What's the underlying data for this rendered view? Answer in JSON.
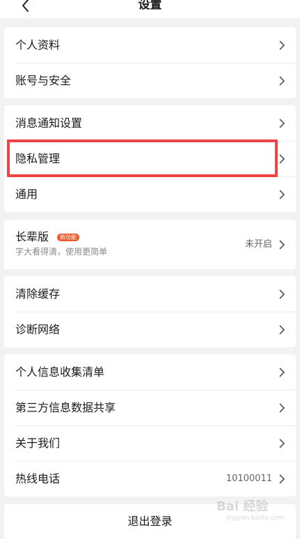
{
  "nav": {
    "title": "设置"
  },
  "groups": [
    {
      "items": [
        {
          "label": "个人资料"
        },
        {
          "label": "账号与安全"
        }
      ]
    },
    {
      "items": [
        {
          "label": "消息通知设置"
        },
        {
          "label": "隐私管理"
        },
        {
          "label": "通用"
        }
      ]
    },
    {
      "elder": {
        "label": "长辈版",
        "badge": "新功能",
        "subtitle": "字大看得清，使用更简单",
        "value": "未开启"
      }
    },
    {
      "items": [
        {
          "label": "清除缓存"
        },
        {
          "label": "诊断网络"
        }
      ]
    },
    {
      "items": [
        {
          "label": "个人信息收集清单"
        },
        {
          "label": "第三方信息数据共享"
        },
        {
          "label": "关于我们"
        },
        {
          "label": "热线电话",
          "value": "10100011"
        }
      ]
    }
  ],
  "logout": {
    "label": "退出登录"
  },
  "watermark": {
    "text": "Bai 经验",
    "sub": "jingyan.baidu.com"
  },
  "colors": {
    "highlight": "#f04343",
    "badge": "#f0592b",
    "background": "#f2f2f2"
  }
}
